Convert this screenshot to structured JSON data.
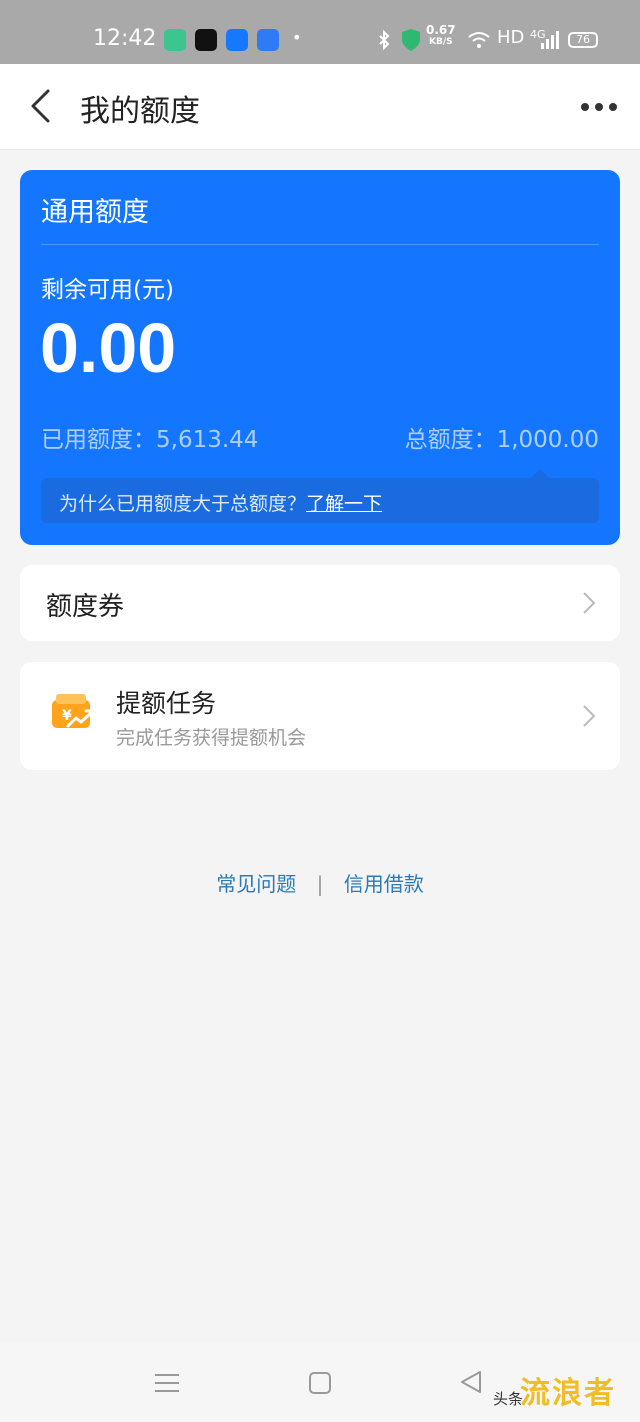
{
  "status_bar": {
    "time": "12:42",
    "dot": "•",
    "speed_value": "0.67",
    "speed_unit": "KB/S",
    "network": "HD",
    "signal": "4G",
    "battery": "76"
  },
  "app_bar": {
    "title": "我的额度",
    "back_icon": "chevron-left-icon",
    "more_icon": "more-dots-icon"
  },
  "quota_card": {
    "title": "通用额度",
    "remain_label": "剩余可用(元)",
    "remain_value": "0.00",
    "used_label": "已用额度：5,613.44",
    "total_label": "总额度：1,000.00",
    "tip_text": "为什么已用额度大于总额度？",
    "tip_link": "了解一下",
    "bg_color": "#1476fe"
  },
  "coupon": {
    "label": "额度券"
  },
  "task": {
    "title": "提额任务",
    "subtitle": "完成任务获得提额机会",
    "icon": "wallet-up-icon"
  },
  "footer": {
    "faq": "常见问题",
    "separator": "|",
    "credit_loan": "信用借款"
  },
  "watermark": {
    "text": "头条",
    "logo": "流浪者"
  }
}
